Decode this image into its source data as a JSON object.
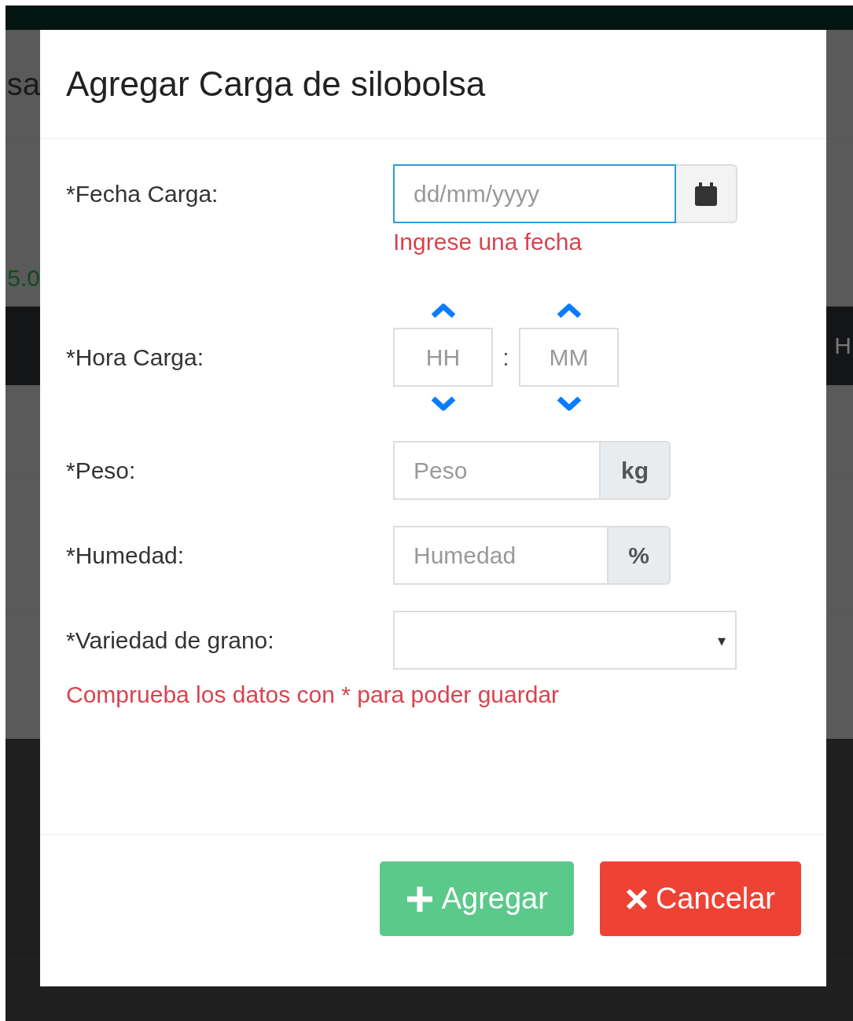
{
  "background": {
    "left_heading": "sa",
    "left_value": "5.0",
    "right_heading": "H"
  },
  "dialog": {
    "title": "Agregar Carga de silobolsa",
    "fields": [
      {
        "kind": "date",
        "label": "*Fecha Carga:",
        "placeholder": "dd/mm/yyyy",
        "focused": true,
        "error": "Ingrese una fecha"
      },
      {
        "kind": "time",
        "label": "*Hora Carga:",
        "hours_placeholder": "HH",
        "separator": ":",
        "minutes_placeholder": "MM"
      },
      {
        "kind": "addon",
        "label": "*Peso:",
        "placeholder": "Peso",
        "unit": "kg"
      },
      {
        "kind": "addon",
        "label": "*Humedad:",
        "placeholder": "Humedad",
        "unit": "%"
      },
      {
        "kind": "select",
        "label": "*Variedad de grano:",
        "caret": "▾"
      }
    ],
    "message": "Comprueba los datos con * para poder guardar",
    "buttons": [
      {
        "kind": "primary",
        "label": "Agregar"
      },
      {
        "kind": "danger",
        "label": "Cancelar"
      }
    ]
  }
}
